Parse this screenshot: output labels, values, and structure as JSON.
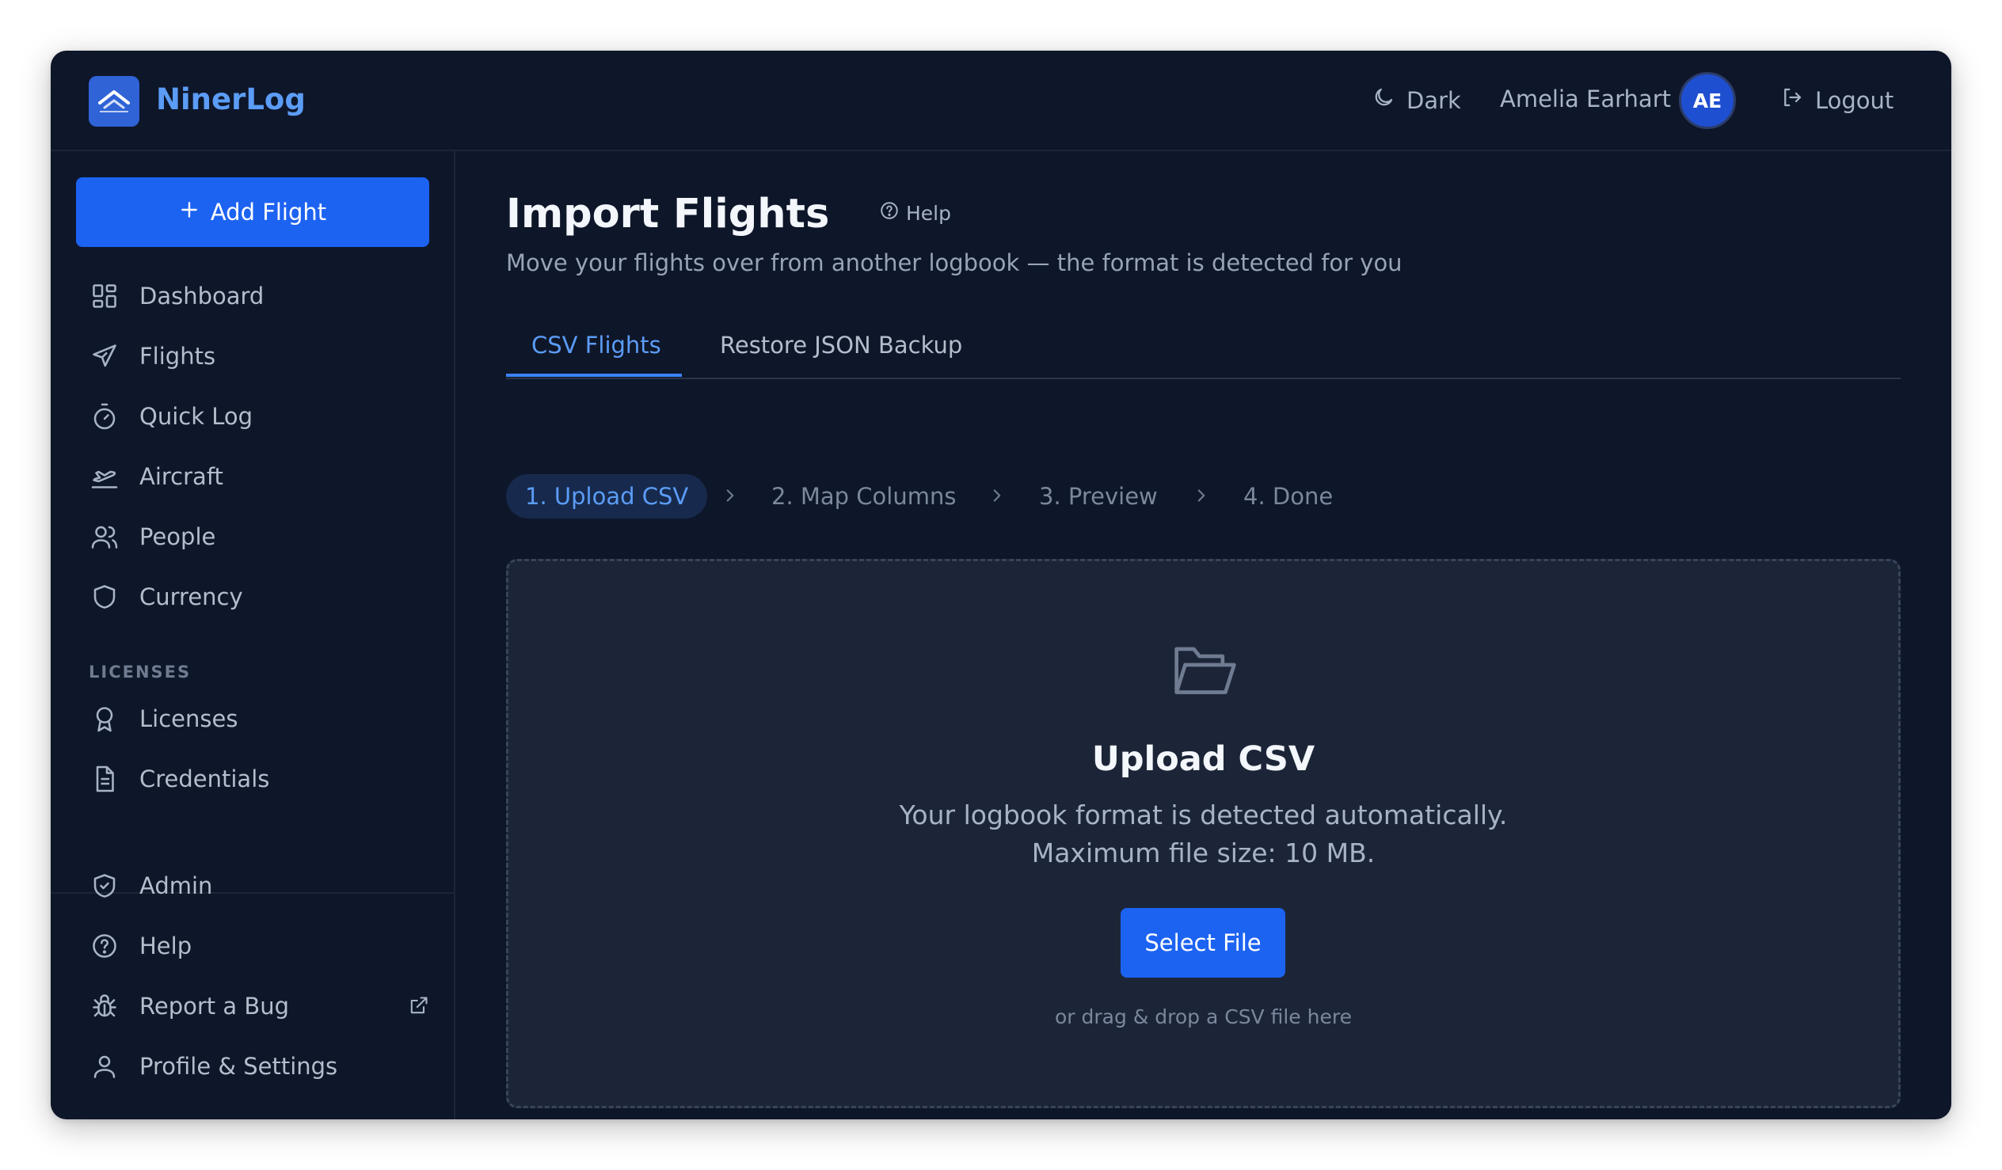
{
  "app": {
    "name": "NinerLog"
  },
  "header": {
    "theme_label": "Dark",
    "user_name": "Amelia Earhart",
    "user_initials": "AE",
    "logout_label": "Logout"
  },
  "sidebar": {
    "add_flight_label": "Add Flight",
    "items": [
      {
        "label": "Dashboard",
        "icon": "dashboard-icon"
      },
      {
        "label": "Flights",
        "icon": "plane-icon"
      },
      {
        "label": "Quick Log",
        "icon": "stopwatch-icon"
      },
      {
        "label": "Aircraft",
        "icon": "plane-takeoff-icon"
      },
      {
        "label": "People",
        "icon": "users-icon"
      },
      {
        "label": "Currency",
        "icon": "shield-icon"
      }
    ],
    "licenses_section": "LICENSES",
    "license_items": [
      {
        "label": "Licenses",
        "icon": "award-icon"
      },
      {
        "label": "Credentials",
        "icon": "document-icon"
      }
    ],
    "bottom_items": [
      {
        "label": "Admin",
        "icon": "shield-check-icon"
      },
      {
        "label": "Help",
        "icon": "help-circle-icon"
      },
      {
        "label": "Report a Bug",
        "icon": "bug-icon"
      },
      {
        "label": "Profile & Settings",
        "icon": "user-icon"
      }
    ]
  },
  "main": {
    "title": "Import Flights",
    "help_label": "Help",
    "subtitle": "Move your flights over from another logbook — the format is detected for you",
    "tabs": [
      {
        "label": "CSV Flights",
        "active": true
      },
      {
        "label": "Restore JSON Backup",
        "active": false
      }
    ],
    "steps": [
      {
        "label": "1. Upload CSV",
        "active": true
      },
      {
        "label": "2. Map Columns",
        "active": false
      },
      {
        "label": "3. Preview",
        "active": false
      },
      {
        "label": "4. Done",
        "active": false
      }
    ],
    "dropzone": {
      "title": "Upload CSV",
      "line1": "Your logbook format is detected automatically.",
      "line2": "Maximum file size: 10 MB.",
      "button_label": "Select File",
      "hint": "or drag & drop a CSV file here"
    }
  },
  "colors": {
    "accent": "#1d63f2",
    "accent_text": "#5b9cf6",
    "background": "#0e1629",
    "surface": "#1c2538"
  }
}
